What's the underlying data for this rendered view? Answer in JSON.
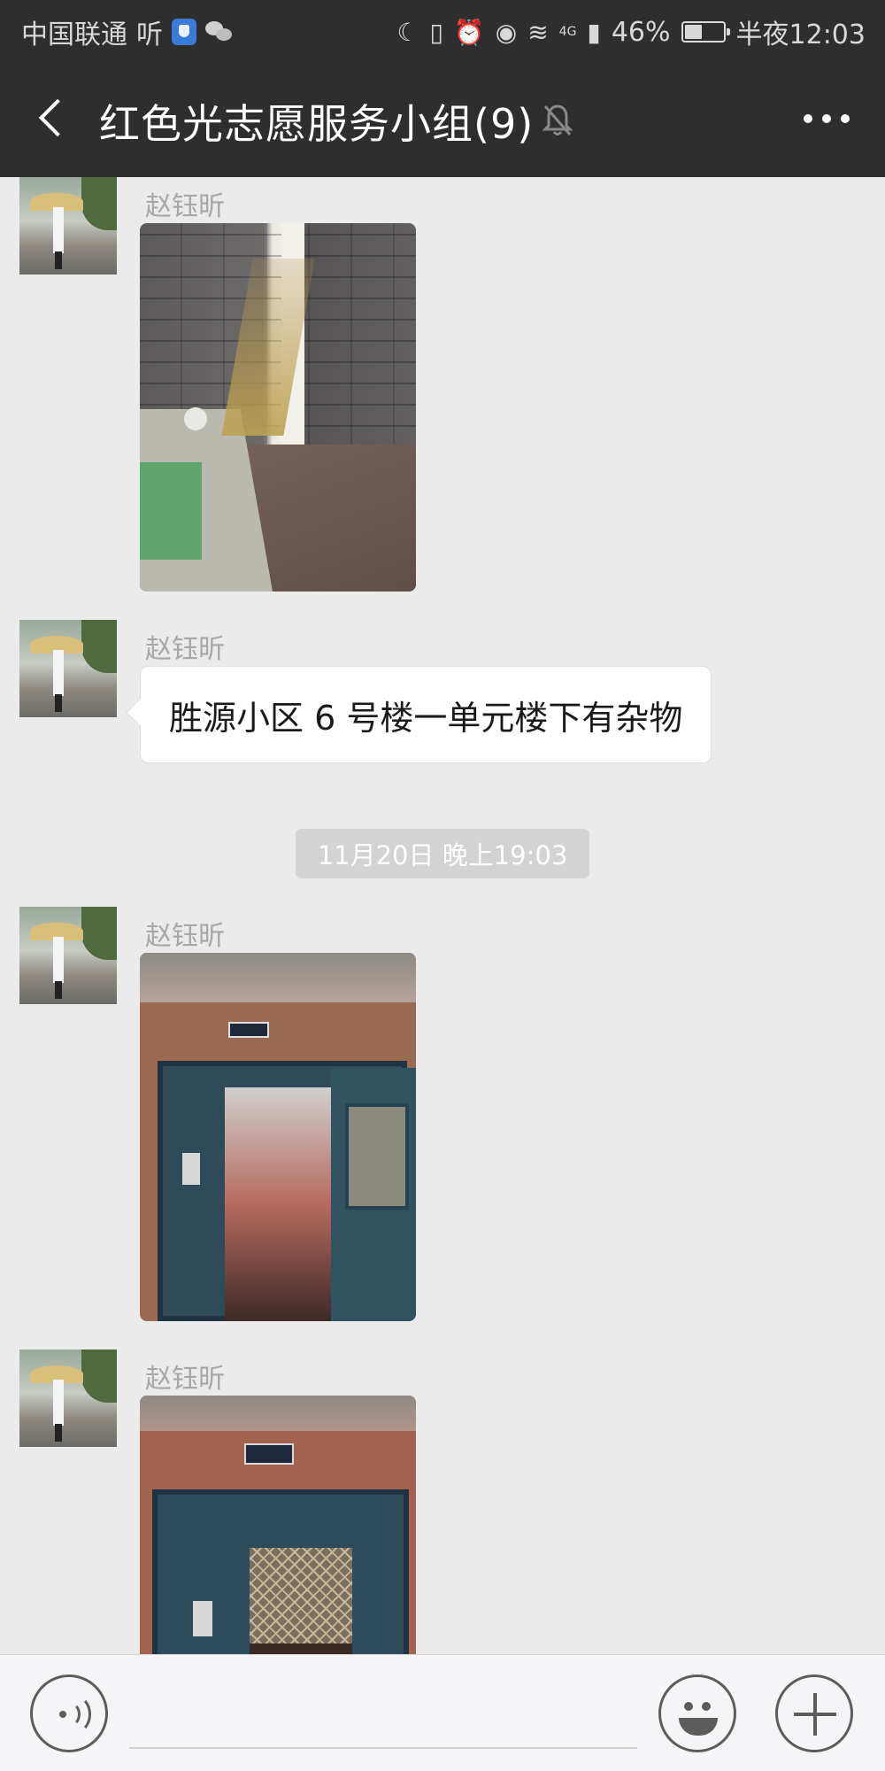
{
  "status_bar": {
    "carrier": "中国联通",
    "carrier_extra": "听",
    "battery_percent": "46%",
    "battery_level": 0.46,
    "network": "4G",
    "time": "半夜12:03"
  },
  "header": {
    "title": "红色光志愿服务小组(9)"
  },
  "messages": [
    {
      "sender": "赵钰昕",
      "type": "image"
    },
    {
      "sender": "赵钰昕",
      "type": "text",
      "text": "胜源小区 6 号楼一单元楼下有杂物"
    },
    {
      "type": "timestamp",
      "text": "11月20日 晚上19:03"
    },
    {
      "sender": "赵钰昕",
      "type": "image"
    },
    {
      "sender": "赵钰昕",
      "type": "image"
    }
  ],
  "input_bar": {
    "placeholder": ""
  }
}
